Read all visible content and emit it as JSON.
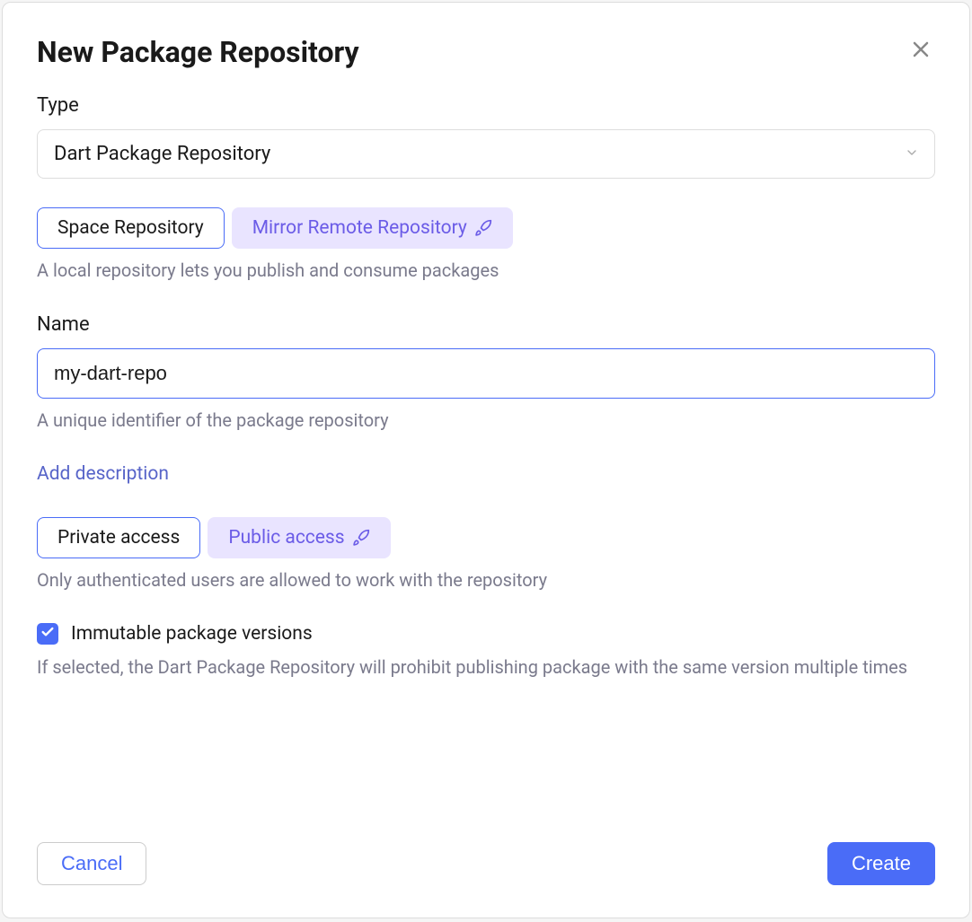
{
  "dialog": {
    "title": "New Package Repository"
  },
  "type": {
    "label": "Type",
    "selected": "Dart Package Repository"
  },
  "repo_mode": {
    "option_local": "Space Repository",
    "option_mirror": "Mirror Remote Repository",
    "helper": "A local repository lets you publish and consume packages"
  },
  "name": {
    "label": "Name",
    "value": "my-dart-repo",
    "helper": "A unique identifier of the package repository"
  },
  "description": {
    "add_link": "Add description"
  },
  "access": {
    "option_private": "Private access",
    "option_public": "Public access",
    "helper": "Only authenticated users are allowed to work with the repository"
  },
  "immutable": {
    "label": "Immutable package versions",
    "helper": "If selected, the Dart Package Repository will prohibit publishing package with the same version multiple times",
    "checked": true
  },
  "footer": {
    "cancel": "Cancel",
    "create": "Create"
  }
}
